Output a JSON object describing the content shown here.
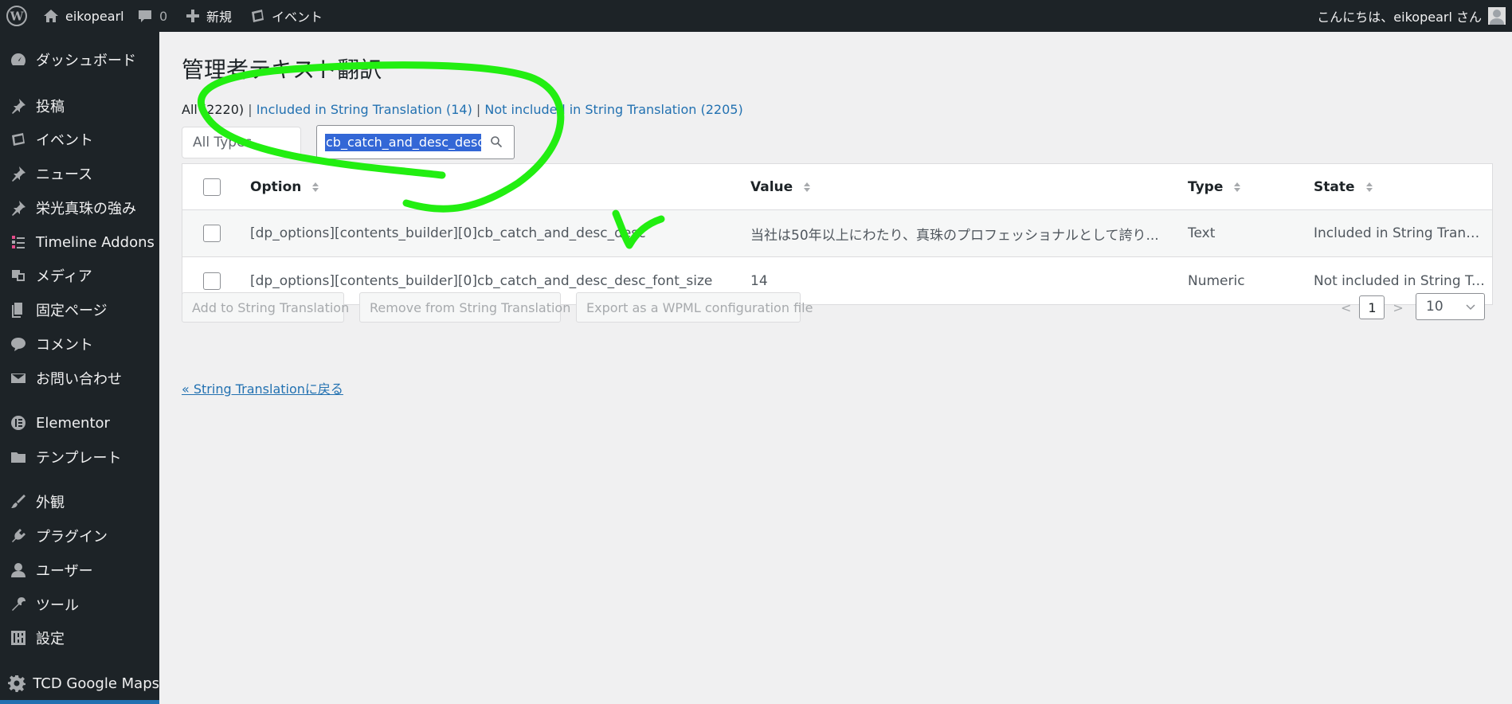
{
  "adminbar": {
    "site_name": "eikopearl",
    "comment_count": "0",
    "new_label": "新規",
    "event_label": "イベント",
    "greeting": "こんにちは、eikopearl さん"
  },
  "sidebar": {
    "items": [
      {
        "label": "ダッシュボード",
        "icon": "dashboard-icon"
      },
      {
        "label": "投稿",
        "icon": "pin-icon"
      },
      {
        "label": "イベント",
        "icon": "event-icon"
      },
      {
        "label": "ニュース",
        "icon": "pin-icon"
      },
      {
        "label": "栄光真珠の強み",
        "icon": "pin-icon"
      },
      {
        "label": "Timeline Addons",
        "icon": "timeline-icon"
      },
      {
        "label": "メディア",
        "icon": "media-icon"
      },
      {
        "label": "固定ページ",
        "icon": "pages-icon"
      },
      {
        "label": "コメント",
        "icon": "comment-icon"
      },
      {
        "label": "お問い合わせ",
        "icon": "mail-icon"
      },
      {
        "label": "Elementor",
        "icon": "elementor-icon"
      },
      {
        "label": "テンプレート",
        "icon": "folder-icon"
      },
      {
        "label": "外観",
        "icon": "brush-icon"
      },
      {
        "label": "プラグイン",
        "icon": "plugin-icon"
      },
      {
        "label": "ユーザー",
        "icon": "user-icon"
      },
      {
        "label": "ツール",
        "icon": "wrench-icon"
      },
      {
        "label": "設定",
        "icon": "settings-icon"
      },
      {
        "label": "TCD Google Maps",
        "icon": "gear-icon"
      }
    ]
  },
  "main": {
    "title": "管理者テキスト翻訳",
    "filters": {
      "all": "All (2220)",
      "sep": "|",
      "included": "Included in String Translation (14)",
      "not_included": "Not included in String Translation (2205)"
    },
    "type_select": "All Types",
    "search_value": "cb_catch_and_desc_desc",
    "table": {
      "headers": {
        "option": "Option",
        "value": "Value",
        "type": "Type",
        "state": "State"
      },
      "rows": [
        {
          "option": "[dp_options][contents_builder][0]cb_catch_and_desc_desc",
          "value": "当社は50年以上にわたり、真珠のプロフェッショナルとして誇り...",
          "type": "Text",
          "state": "Included in String Translat..."
        },
        {
          "option": "[dp_options][contents_builder][0]cb_catch_and_desc_desc_font_size",
          "value": "14",
          "type": "Numeric",
          "state": "Not included in String Tra..."
        }
      ]
    },
    "buttons": {
      "add": "Add to String Translation",
      "remove": "Remove from String Translation",
      "export": "Export as a WPML configuration file"
    },
    "pagination": {
      "prev": "<",
      "page": "1",
      "next": ">",
      "per_page": "10"
    },
    "back_link": "« String Translationに戻る"
  },
  "annotation_color": "#22ee11"
}
